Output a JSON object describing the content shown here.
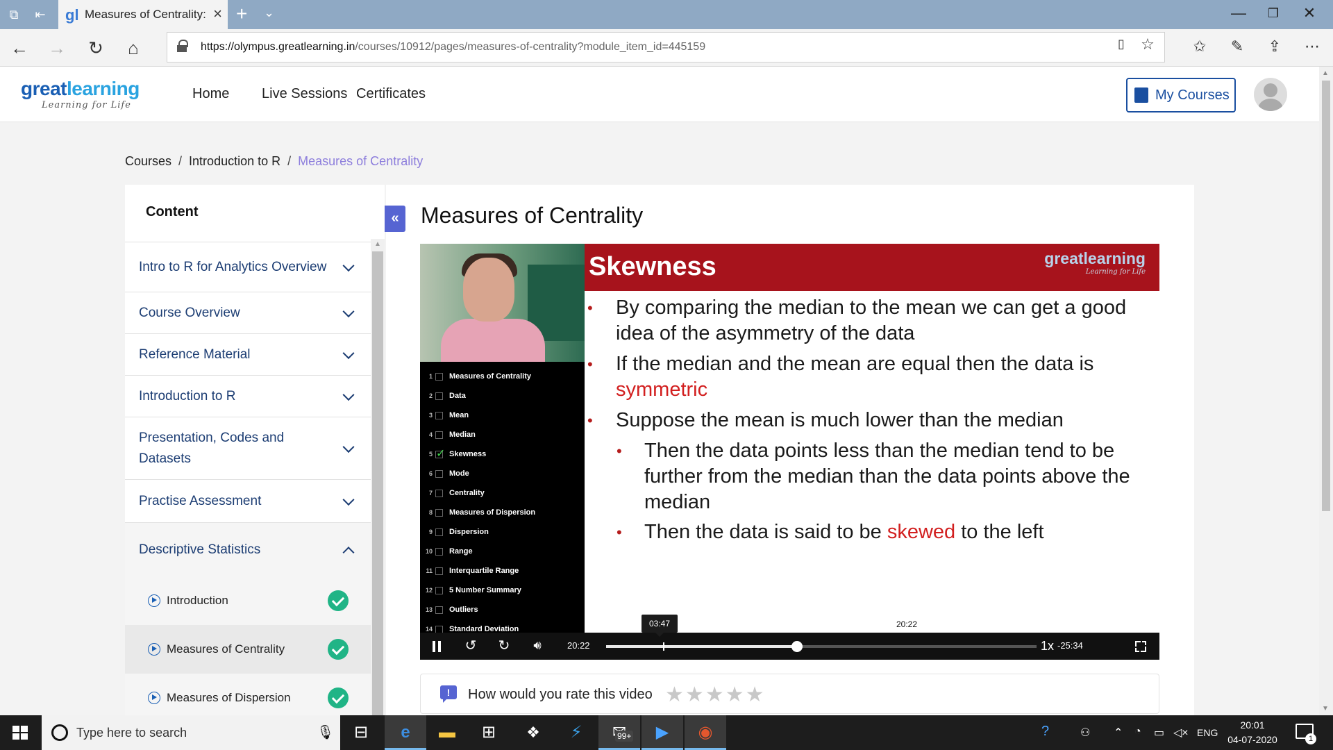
{
  "browser": {
    "tab_title": "Measures of Centrality:",
    "url_host": "https://olympus.greatlearning.in",
    "url_path": "/courses/10912/pages/measures-of-centrality?module_item_id=445159"
  },
  "header": {
    "logo_main_a": "great",
    "logo_main_b": "learning",
    "logo_sub": "Learning for Life",
    "nav": [
      "Home",
      "Live Sessions",
      "Certificates"
    ],
    "my_courses": "My Courses"
  },
  "breadcrumb": {
    "items": [
      "Courses",
      "Introduction to R",
      "Measures of Centrality"
    ],
    "separator": "/"
  },
  "sidebar": {
    "title": "Content",
    "modules": [
      "Intro to R for Analytics Overview",
      "Course Overview",
      "Reference Material",
      "Introduction to R",
      "Presentation, Codes and Datasets",
      "Practise Assessment",
      "Descriptive Statistics"
    ],
    "sub_items": [
      "Introduction",
      "Measures of Centrality",
      "Measures of Dispersion"
    ]
  },
  "main": {
    "title": "Measures of Centrality"
  },
  "video": {
    "toc": [
      "Measures of Centrality",
      "Data",
      "Mean",
      "Median",
      "Skewness",
      "Mode",
      "Centrality",
      "Measures of Dispersion",
      "Dispersion",
      "Range",
      "Interquartile Range",
      "5 Number Summary",
      "Outliers",
      "Standard Deviation"
    ],
    "toc_checked_index": 4,
    "slide_title": "Skewness",
    "slide_logo_main": "greatlearning",
    "slide_logo_sub": "Learning for Life",
    "b1": "By comparing the median to the mean we can get a good idea of the asymmetry of the data",
    "b2_pre": "If the median and the mean are equal then the data is ",
    "b2_red": "symmetric",
    "b3": "Suppose the mean is much lower than the median",
    "s1": "Then the data points less than the median tend to be further from the median than the data points above the median",
    "s2_pre": "Then the data is said to be ",
    "s2_red": "skewed",
    "s2_post": " to the left",
    "current_time": "20:22",
    "remaining_time": "-25:34",
    "hover_time": "03:47",
    "knob_time": "20:22",
    "speed": "1x",
    "progress_fraction": 0.443
  },
  "rating": {
    "prompt": "How would you rate this video",
    "stars": "★★★★★"
  },
  "taskbar": {
    "search_placeholder": "Type here to search",
    "mail_badge": "99+",
    "lang": "ENG",
    "time": "20:01",
    "date": "04-07-2020",
    "notif_count": "1"
  },
  "colors": {
    "brand_blue": "#1a5fb4",
    "accent_purple": "#5664d2",
    "slide_red": "#a7131c",
    "check_green": "#20b486"
  }
}
